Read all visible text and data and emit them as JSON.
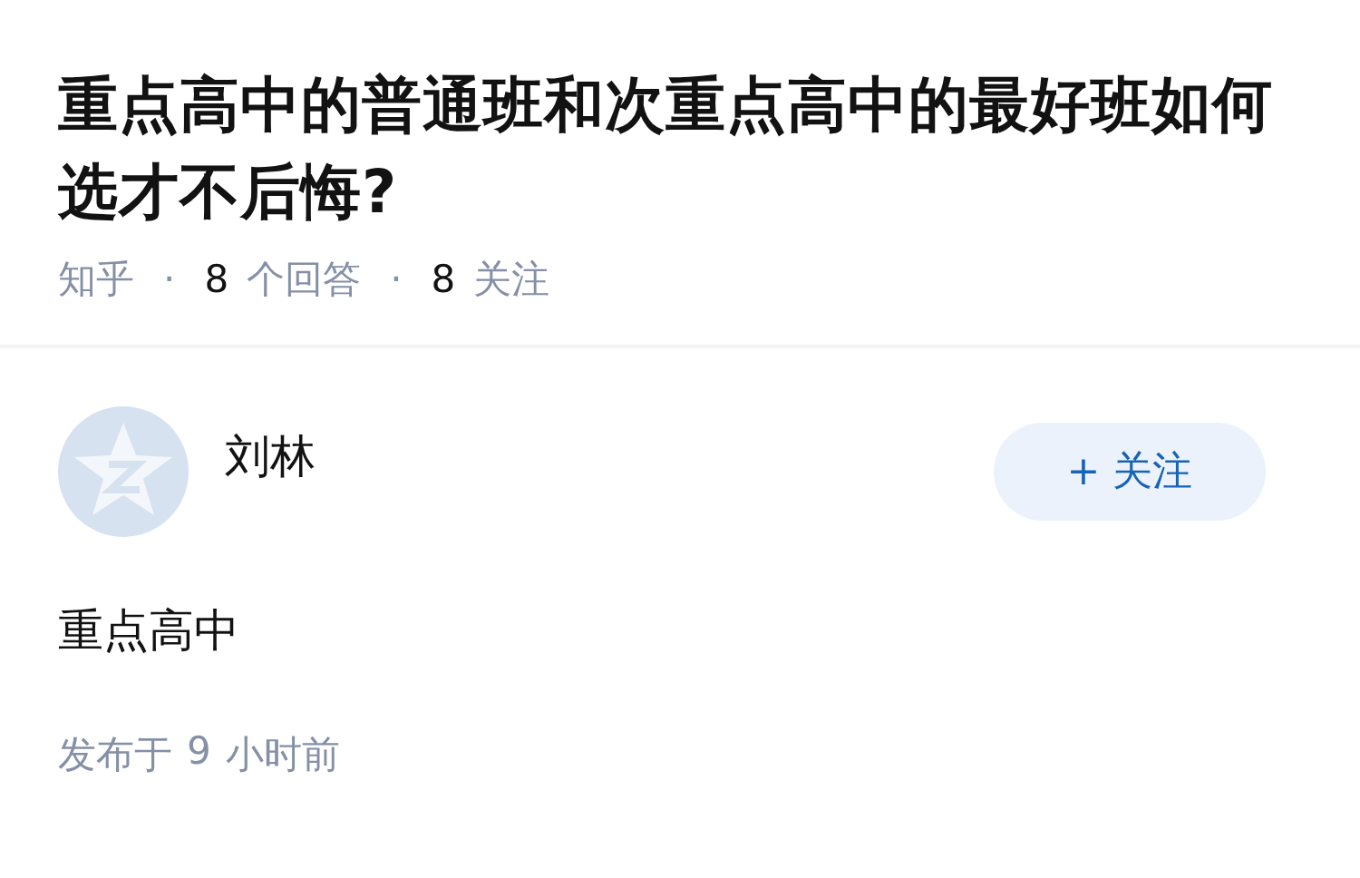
{
  "question": {
    "title": "重点高中的普通班和次重点高中的最好班如何选才不后悔?",
    "meta": {
      "source": "知乎",
      "stats": [
        {
          "separator": "·",
          "count": "8",
          "label": "个回答"
        },
        {
          "separator": "·",
          "count": "8",
          "label": "关注"
        }
      ]
    }
  },
  "answer": {
    "author": "刘林",
    "follow_button": "+ 关注",
    "content": "重点高中",
    "posted": {
      "label": "发布于",
      "count": "9",
      "unit": "小时前"
    }
  }
}
